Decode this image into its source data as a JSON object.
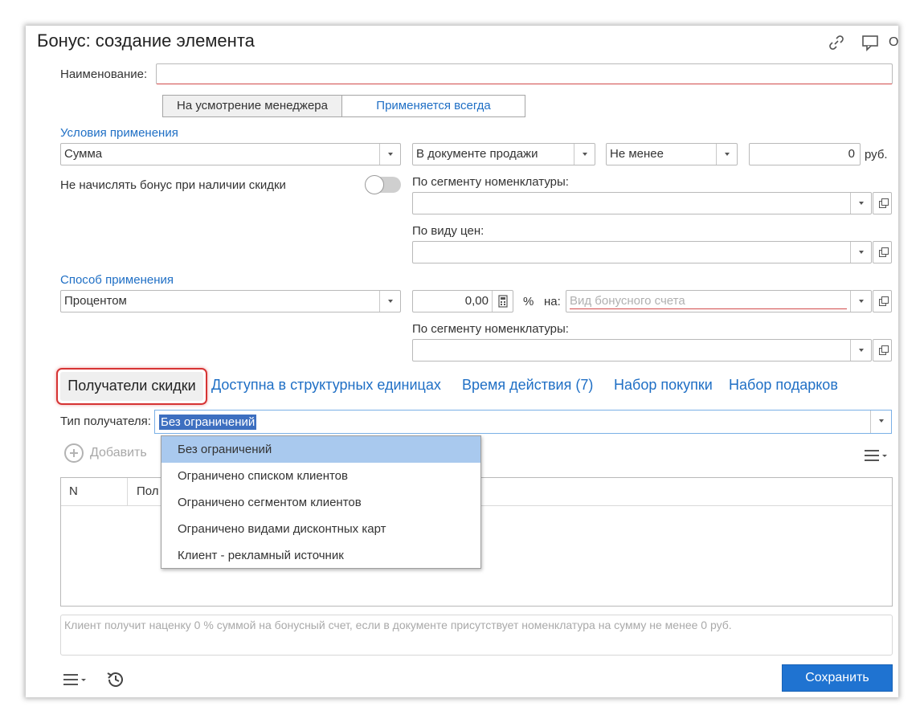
{
  "window": {
    "title": "Бонус: создание элемента",
    "header_cut_text": "О"
  },
  "name": {
    "label": "Наименование:",
    "value": ""
  },
  "mode_toggle": {
    "options": [
      "На усмотрение менеджера",
      "Применяется всегда"
    ],
    "active_index": 0
  },
  "conditions": {
    "section_title": "Условия применения",
    "condition_type": "Сумма",
    "document": "В документе продажи",
    "comparison": "Не менее",
    "amount": "0",
    "currency": "руб.",
    "no_bonus_label": "Не начислять бонус при наличии скидки",
    "no_bonus_enabled": false,
    "segment_label": "По сегменту номенклатуры:",
    "segment_value": "",
    "price_type_label": "По виду цен:",
    "price_type_value": ""
  },
  "application": {
    "section_title": "Способ применения",
    "method": "Процентом",
    "percent_value": "0,00",
    "percent_sign": "%",
    "on_label": "на:",
    "account_placeholder": "Вид бонусного счета",
    "segment_label": "По сегменту номенклатуры:",
    "segment_value": ""
  },
  "tabs": [
    "Получатели скидки",
    "Доступна в структурных единицах",
    "Время действия (7)",
    "Набор покупки",
    "Набор подарков"
  ],
  "recipients": {
    "type_label": "Тип получателя:",
    "type_value": "Без ограничений",
    "dropdown_options": [
      "Без ограничений",
      "Ограничено списком клиентов",
      "Ограничено сегментом клиентов",
      "Ограничено видами дисконтных карт",
      "Клиент - рекламный источник"
    ],
    "selected_option_index": 0,
    "add_label": "Добавить",
    "table_columns": [
      "N",
      "Пол"
    ]
  },
  "note_text": "Клиент получит наценку 0 % суммой на бонусный счет, если в документе присутствует номенклатура на сумму не менее 0 руб.",
  "footer": {
    "save_label": "Сохранить"
  },
  "colors": {
    "accent": "#1f6fc5",
    "save_button": "#1f73d1",
    "selection": "#3d6fc0",
    "dropdown_highlight": "#a9c9ee",
    "tab_highlight_border": "#d63333"
  }
}
